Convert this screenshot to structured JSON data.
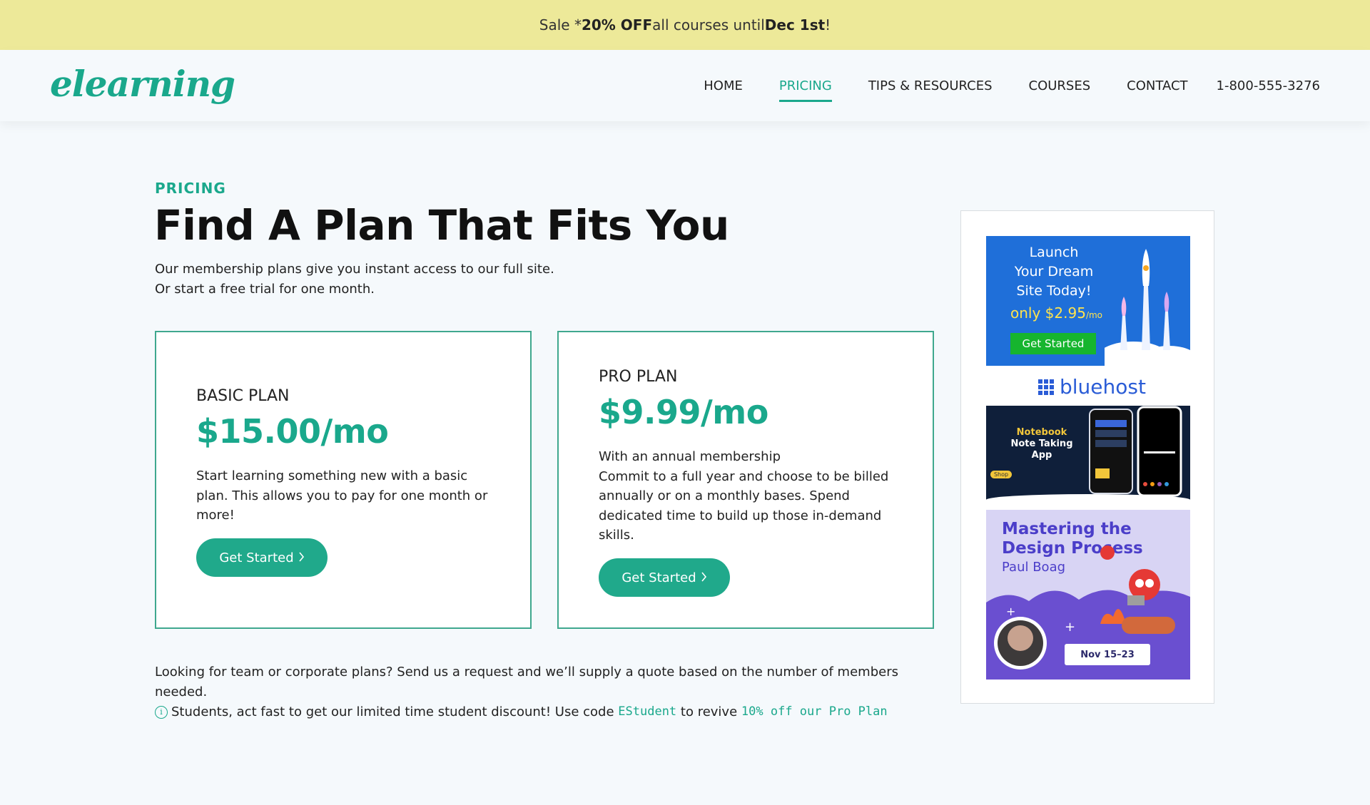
{
  "banner": {
    "pre": "Sale * ",
    "bold1": "20% OFF",
    "mid": " all courses until ",
    "bold2": "Dec 1st",
    "post": "!"
  },
  "header": {
    "logo": "elearning",
    "nav": [
      {
        "label": "HOME",
        "active": false
      },
      {
        "label": "PRICING",
        "active": true
      },
      {
        "label": "TIPS & RESOURCES",
        "active": false
      },
      {
        "label": "COURSES",
        "active": false
      },
      {
        "label": "CONTACT",
        "active": false
      }
    ],
    "phone": "1-800-555-3276"
  },
  "main": {
    "eyebrow": "PRICING",
    "title": "Find A Plan That Fits You",
    "intro_line1": "Our membership plans give you instant access to our full site.",
    "intro_line2": "Or start a free trial for one month."
  },
  "plans": [
    {
      "name": "BASIC PLAN",
      "price": "$15.00/mo",
      "description": "Start learning something new with a basic plan. This allows you to pay for one month or more!",
      "button": "Get Started"
    },
    {
      "name": "PRO PLAN",
      "price": "$9.99/mo",
      "subtitle": "With an annual membership",
      "description": "Commit to a full year and choose to be billed annually or on a monthly bases. Spend dedicated time to build up those in-demand skills.",
      "button": "Get Started"
    }
  ],
  "footer_note": "Looking for team or corporate plans? Send us a request and we’ll supply a quote based on the number of members needed.",
  "student": {
    "text1": "Students, act fast to get our limited time student discount! Use code ",
    "code": "EStudent",
    "text2": " to revive ",
    "offer": "10% off our Pro Plan"
  },
  "ads": {
    "bluehost": {
      "line1": "Launch",
      "line2": "Your Dream",
      "line3": "Site Today!",
      "price_prefix": "only ",
      "price": "$2.95",
      "price_unit": "/mo",
      "button": "Get Started",
      "brand": "bluehost"
    },
    "notebook": {
      "line1": "Notebook",
      "line2": "Note Taking",
      "line3": "App",
      "badge": "Shop"
    },
    "design": {
      "title": "Mastering the Design Process",
      "author": "Paul Boag",
      "date": "Nov 15–23"
    }
  },
  "colors": {
    "accent": "#1aa88c",
    "banner_bg": "#ede999",
    "button": "#20a98b"
  }
}
